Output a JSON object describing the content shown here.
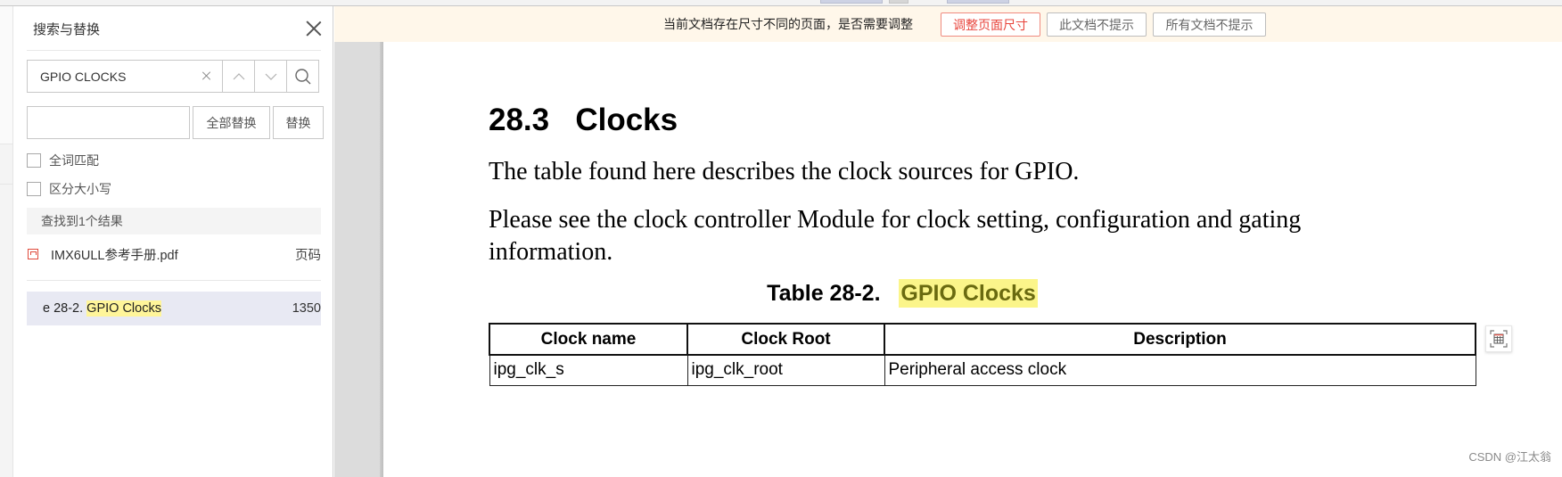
{
  "search_panel": {
    "title": "搜索与替换",
    "search_value": "GPIO CLOCKS",
    "replace_value": "",
    "replace_all_label": "全部替换",
    "replace_label": "替换",
    "options": [
      {
        "label": "全词匹配",
        "checked": false
      },
      {
        "label": "区分大小写",
        "checked": false
      }
    ],
    "result_summary": "查找到1个结果",
    "file": {
      "name": "IMX6ULL参考手册.pdf",
      "page_header": "页码"
    },
    "results": [
      {
        "prefix": "e 28-2. ",
        "match": "GPIO Clocks",
        "page": "1350"
      }
    ]
  },
  "notice": {
    "message": "当前文档存在尺寸不同的页面，是否需要调整",
    "adjust_label": "调整页面尺寸",
    "skip_doc_label": "此文档不提示",
    "skip_all_label": "所有文档不提示"
  },
  "document": {
    "section_number": "28.3",
    "section_title": "Clocks",
    "paragraph1": "The table found here describes the clock sources for GPIO.",
    "paragraph2": "Please see the clock controller Module for clock setting, configuration and gating information.",
    "table_caption_prefix": "Table 28-2.",
    "table_caption_match": "GPIO Clocks",
    "table": {
      "headers": [
        "Clock name",
        "Clock Root",
        "Description"
      ],
      "rows": [
        [
          "ipg_clk_s",
          "ipg_clk_root",
          "Peripheral access clock"
        ]
      ]
    }
  },
  "watermark": "CSDN @江太翁",
  "colors": {
    "highlight": "#fff59a",
    "accent_red": "#e8453c",
    "notice_bg": "#fff7ea",
    "selected_result_bg": "#e8e9f3"
  }
}
